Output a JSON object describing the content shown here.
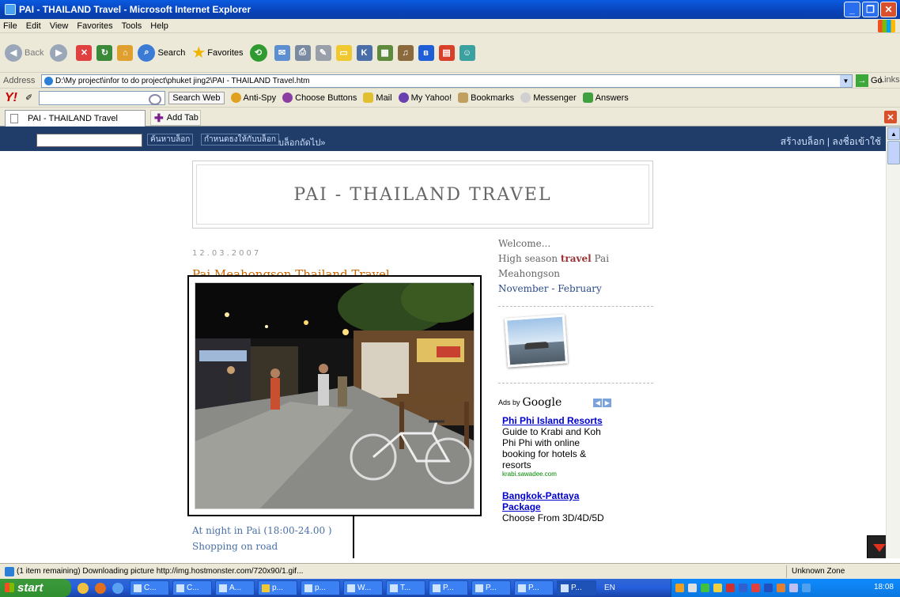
{
  "window": {
    "title": "PAI - THAILAND Travel - Microsoft Internet Explorer"
  },
  "menu": [
    "File",
    "Edit",
    "View",
    "Favorites",
    "Tools",
    "Help"
  ],
  "toolbar": {
    "back_label": "Back",
    "search_label": "Search",
    "favorites_label": "Favorites"
  },
  "address": {
    "label": "Address",
    "value": "D:\\My project\\infor to do project\\phuket jing2\\PAI - THAILAND Travel.htm",
    "go_label": "Go",
    "links_label": "Links"
  },
  "yahoo": {
    "search_web_label": "Search Web",
    "antispy_label": "Anti-Spy",
    "choose_buttons_label": "Choose Buttons",
    "mail_label": "Mail",
    "my_yahoo_label": "My Yahoo!",
    "bookmarks_label": "Bookmarks",
    "messenger_label": "Messenger",
    "answers_label": "Answers"
  },
  "tabs": {
    "active_label": "PAI - THAILAND Travel",
    "add_tab_label": "Add Tab"
  },
  "blogger_nav": {
    "search_button": "ค้นหาบล็อก",
    "flag_button": "กำหนดธงให้กับบล็อก",
    "next_blog": "บล็อกถัดไป»",
    "right_links": "สร้างบล็อก | ลงชื่อเข้าใช้"
  },
  "blog": {
    "title": "PAI - THAILAND TRAVEL",
    "post_date": "12.03.2007",
    "post_title": "Pai Meahongson Thailand Travel",
    "caption_line1": "At night in Pai (18:00-24.00 )",
    "caption_line2": "Shopping on road"
  },
  "sidebar": {
    "welcome": "Welcome...",
    "high_season_prefix": "High season ",
    "high_season_bold": "travel",
    "high_season_suffix": " Pai",
    "location": "Meahongson",
    "months": "November - February",
    "ads_by": "Ads by",
    "google": "Google",
    "ads": [
      {
        "title": "Phi Phi Island Resorts",
        "text": "Guide to Krabi and Koh Phi Phi with online booking for hotels & resorts",
        "url": "krabi.sawadee.com"
      },
      {
        "title": "Bangkok-Pattaya Package",
        "text": "Choose From 3D/4D/5D",
        "url": ""
      }
    ]
  },
  "status": {
    "text": "(1 item remaining) Downloading picture http://img.hostmonster.com/720x90/1.gif...",
    "zone": "Unknown Zone"
  },
  "taskbar": {
    "start_label": "start",
    "tasks": [
      "C...",
      "C...",
      "A...",
      "p...",
      "p...",
      "W...",
      "T...",
      "P...",
      "P...",
      "P...",
      "P..."
    ],
    "language": "EN",
    "clock": "18:08"
  },
  "colors": {
    "title_bar": "#0842b8",
    "blogger_nav": "#1f3d68",
    "post_title": "#cc6600",
    "ad_link": "#0000cc"
  }
}
